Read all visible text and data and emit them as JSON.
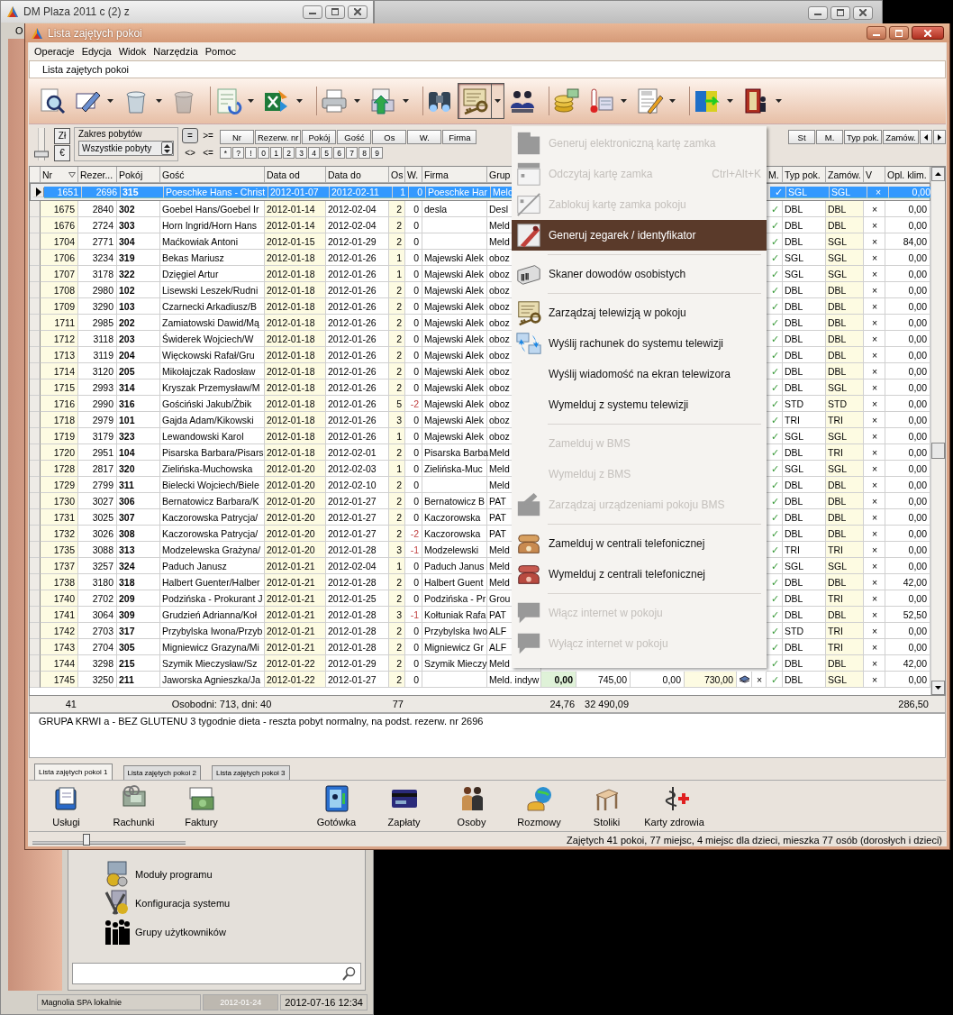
{
  "background_window": {
    "title": "DM Plaza 2011 c (2) z",
    "menu": [
      "O"
    ],
    "panel_items": [
      "Moduły programu",
      "Konfiguracja systemu",
      "Grupy użytkowników"
    ],
    "status_bar": [
      {
        "text": "Magnolia SPA lokalnie",
        "disabled": false
      },
      {
        "text": "2012-01-24",
        "disabled": true
      },
      {
        "text": "2012-07-16 12:34",
        "disabled": false
      }
    ]
  },
  "window": {
    "title": "Lista zajętych pokoi"
  },
  "menu_bar": [
    "Operacje",
    "Edycja",
    "Widok",
    "Narzędzia",
    "Pomoc"
  ],
  "document_tab": "Lista zajętych pokoi",
  "toolbar": [
    {
      "dropdown": false,
      "disabled": false,
      "pressed": false,
      "separator_before": false
    },
    {
      "dropdown": true,
      "disabled": false,
      "pressed": false,
      "separator_before": false
    },
    {
      "dropdown": true,
      "disabled": false,
      "pressed": false,
      "separator_before": false
    },
    {
      "dropdown": false,
      "disabled": true,
      "pressed": false,
      "separator_before": false
    },
    {
      "dropdown": true,
      "disabled": false,
      "pressed": false,
      "separator_before": true
    },
    {
      "dropdown": true,
      "disabled": false,
      "pressed": false,
      "separator_before": false
    },
    {
      "dropdown": true,
      "disabled": false,
      "pressed": false,
      "separator_before": true
    },
    {
      "dropdown": true,
      "disabled": false,
      "pressed": false,
      "separator_before": false
    },
    {
      "dropdown": false,
      "disabled": false,
      "pressed": false,
      "separator_before": true
    },
    {
      "dropdown": true,
      "disabled": false,
      "pressed": true,
      "separator_before": false
    },
    {
      "dropdown": false,
      "disabled": false,
      "pressed": false,
      "separator_before": false
    },
    {
      "dropdown": false,
      "disabled": false,
      "pressed": false,
      "separator_before": true
    },
    {
      "dropdown": true,
      "disabled": false,
      "pressed": false,
      "separator_before": false
    },
    {
      "dropdown": true,
      "disabled": false,
      "pressed": false,
      "separator_before": false
    },
    {
      "dropdown": true,
      "disabled": false,
      "pressed": false,
      "separator_before": true
    },
    {
      "dropdown": true,
      "disabled": false,
      "pressed": false,
      "separator_before": false
    }
  ],
  "filter": {
    "slider": {
      "level": 0.2
    },
    "currency_buttons": [
      "Zł",
      "€"
    ],
    "range": {
      "label": "Zakres pobytów",
      "value": "Wszystkie pobyty"
    },
    "operators": [
      {
        "label": "=",
        "selected": true
      },
      {
        "label": ">=",
        "selected": false
      },
      {
        "label": "<>",
        "selected": false
      },
      {
        "label": "<=",
        "selected": false
      }
    ],
    "column_buttons": [
      "Nr",
      "Rezerw. nr",
      "Pokój",
      "Gość",
      "Os",
      "W.",
      "Firma"
    ],
    "column_buttons_right": [
      "St",
      "M.",
      "Typ pok.",
      "Zamów."
    ],
    "char_buttons": [
      "*",
      "?",
      "!",
      "0",
      "1",
      "2",
      "3",
      "4",
      "5",
      "6",
      "7",
      "8",
      "9"
    ]
  },
  "table": {
    "columns": [
      "Nr",
      "Rezer...",
      "Pokój",
      "Gość",
      "Data od",
      "Data do",
      "Os",
      "W.",
      "Firma",
      "Grup",
      "M.",
      "Typ pok.",
      "Zamów.",
      "V",
      "Opl. klim."
    ],
    "rows": [
      {
        "nr": "1651",
        "rezerwacja": "2696",
        "pokoj": "315",
        "gosc": "Poeschke Hans - Christ",
        "data_od": "2012-01-07",
        "data_do": "2012-02-11",
        "os": "1",
        "w": "0",
        "firma": "Poeschke Har",
        "grupa": "Meld",
        "m": "✓",
        "typ_pok": "SGL",
        "zamow": "SGL",
        "v": "×",
        "opl_klim": "0,00",
        "selected": true
      },
      {
        "nr": "1675",
        "rezerwacja": "2840",
        "pokoj": "302",
        "gosc": "Goebel Hans/Goebel Ir",
        "data_od": "2012-01-14",
        "data_do": "2012-02-04",
        "os": "2",
        "w": "0",
        "firma": "desla",
        "grupa": "Desl",
        "m": "✓",
        "typ_pok": "DBL",
        "zamow": "DBL",
        "v": "×",
        "opl_klim": "0,00",
        "selected": false
      },
      {
        "nr": "1676",
        "rezerwacja": "2724",
        "pokoj": "303",
        "gosc": "Horn Ingrid/Horn Hans",
        "data_od": "2012-01-14",
        "data_do": "2012-02-04",
        "os": "2",
        "w": "0",
        "firma": "",
        "grupa": "Meld",
        "m": "✓",
        "typ_pok": "DBL",
        "zamow": "DBL",
        "v": "×",
        "opl_klim": "0,00",
        "selected": false
      },
      {
        "nr": "1704",
        "rezerwacja": "2771",
        "pokoj": "304",
        "gosc": "Maćkowiak Antoni",
        "data_od": "2012-01-15",
        "data_do": "2012-01-29",
        "os": "2",
        "w": "0",
        "firma": "",
        "grupa": "Meld",
        "m": "✓",
        "typ_pok": "DBL",
        "zamow": "SGL",
        "v": "×",
        "opl_klim": "84,00",
        "selected": false
      },
      {
        "nr": "1706",
        "rezerwacja": "3234",
        "pokoj": "319",
        "gosc": "Bekas Mariusz",
        "data_od": "2012-01-18",
        "data_do": "2012-01-26",
        "os": "1",
        "w": "0",
        "firma": "Majewski Alek",
        "grupa": "oboz",
        "m": "✓",
        "typ_pok": "SGL",
        "zamow": "SGL",
        "v": "×",
        "opl_klim": "0,00",
        "selected": false
      },
      {
        "nr": "1707",
        "rezerwacja": "3178",
        "pokoj": "322",
        "gosc": "Dzięgiel Artur",
        "data_od": "2012-01-18",
        "data_do": "2012-01-26",
        "os": "1",
        "w": "0",
        "firma": "Majewski Alek",
        "grupa": "oboz",
        "m": "✓",
        "typ_pok": "SGL",
        "zamow": "SGL",
        "v": "×",
        "opl_klim": "0,00",
        "selected": false
      },
      {
        "nr": "1708",
        "rezerwacja": "2980",
        "pokoj": "102",
        "gosc": "Lisewski Leszek/Rudni",
        "data_od": "2012-01-18",
        "data_do": "2012-01-26",
        "os": "2",
        "w": "0",
        "firma": "Majewski Alek",
        "grupa": "oboz",
        "m": "✓",
        "typ_pok": "DBL",
        "zamow": "DBL",
        "v": "×",
        "opl_klim": "0,00",
        "selected": false
      },
      {
        "nr": "1709",
        "rezerwacja": "3290",
        "pokoj": "103",
        "gosc": "Czarnecki Arkadiusz/B",
        "data_od": "2012-01-18",
        "data_do": "2012-01-26",
        "os": "2",
        "w": "0",
        "firma": "Majewski Alek",
        "grupa": "oboz",
        "m": "✓",
        "typ_pok": "DBL",
        "zamow": "DBL",
        "v": "×",
        "opl_klim": "0,00",
        "selected": false
      },
      {
        "nr": "1711",
        "rezerwacja": "2985",
        "pokoj": "202",
        "gosc": "Zamiatowski Dawid/Mą",
        "data_od": "2012-01-18",
        "data_do": "2012-01-26",
        "os": "2",
        "w": "0",
        "firma": "Majewski Alek",
        "grupa": "oboz",
        "m": "✓",
        "typ_pok": "DBL",
        "zamow": "DBL",
        "v": "×",
        "opl_klim": "0,00",
        "selected": false
      },
      {
        "nr": "1712",
        "rezerwacja": "3118",
        "pokoj": "203",
        "gosc": "Świderek Wojciech/W",
        "data_od": "2012-01-18",
        "data_do": "2012-01-26",
        "os": "2",
        "w": "0",
        "firma": "Majewski Alek",
        "grupa": "oboz",
        "m": "✓",
        "typ_pok": "DBL",
        "zamow": "DBL",
        "v": "×",
        "opl_klim": "0,00",
        "selected": false
      },
      {
        "nr": "1713",
        "rezerwacja": "3119",
        "pokoj": "204",
        "gosc": "Więckowski Rafał/Gru",
        "data_od": "2012-01-18",
        "data_do": "2012-01-26",
        "os": "2",
        "w": "0",
        "firma": "Majewski Alek",
        "grupa": "oboz",
        "m": "✓",
        "typ_pok": "DBL",
        "zamow": "DBL",
        "v": "×",
        "opl_klim": "0,00",
        "selected": false
      },
      {
        "nr": "1714",
        "rezerwacja": "3120",
        "pokoj": "205",
        "gosc": "Mikołajczak Radosław",
        "data_od": "2012-01-18",
        "data_do": "2012-01-26",
        "os": "2",
        "w": "0",
        "firma": "Majewski Alek",
        "grupa": "oboz",
        "m": "✓",
        "typ_pok": "DBL",
        "zamow": "DBL",
        "v": "×",
        "opl_klim": "0,00",
        "selected": false
      },
      {
        "nr": "1715",
        "rezerwacja": "2993",
        "pokoj": "314",
        "gosc": "Kryszak Przemysław/M",
        "data_od": "2012-01-18",
        "data_do": "2012-01-26",
        "os": "2",
        "w": "0",
        "firma": "Majewski Alek",
        "grupa": "oboz",
        "m": "✓",
        "typ_pok": "DBL",
        "zamow": "SGL",
        "v": "×",
        "opl_klim": "0,00",
        "selected": false
      },
      {
        "nr": "1716",
        "rezerwacja": "2990",
        "pokoj": "316",
        "gosc": "Gościński  Jakub/Żbik",
        "data_od": "2012-01-18",
        "data_do": "2012-01-26",
        "os": "5",
        "w": "-2",
        "firma": "Majewski Alek",
        "grupa": "oboz",
        "m": "✓",
        "typ_pok": "STD",
        "zamow": "STD",
        "v": "×",
        "opl_klim": "0,00",
        "selected": false
      },
      {
        "nr": "1718",
        "rezerwacja": "2979",
        "pokoj": "101",
        "gosc": "Gajda Adam/Kikowski",
        "data_od": "2012-01-18",
        "data_do": "2012-01-26",
        "os": "3",
        "w": "0",
        "firma": "Majewski Alek",
        "grupa": "oboz",
        "m": "✓",
        "typ_pok": "TRI",
        "zamow": "TRI",
        "v": "×",
        "opl_klim": "0,00",
        "selected": false
      },
      {
        "nr": "1719",
        "rezerwacja": "3179",
        "pokoj": "323",
        "gosc": "Lewandowski Karol",
        "data_od": "2012-01-18",
        "data_do": "2012-01-26",
        "os": "1",
        "w": "0",
        "firma": "Majewski Alek",
        "grupa": "oboz",
        "m": "✓",
        "typ_pok": "SGL",
        "zamow": "SGL",
        "v": "×",
        "opl_klim": "0,00",
        "selected": false
      },
      {
        "nr": "1720",
        "rezerwacja": "2951",
        "pokoj": "104",
        "gosc": "Pisarska Barbara/Pisars",
        "data_od": "2012-01-18",
        "data_do": "2012-02-01",
        "os": "2",
        "w": "0",
        "firma": "Pisarska Barba",
        "grupa": "Meld",
        "m": "✓",
        "typ_pok": "DBL",
        "zamow": "TRI",
        "v": "×",
        "opl_klim": "0,00",
        "selected": false
      },
      {
        "nr": "1728",
        "rezerwacja": "2817",
        "pokoj": "320",
        "gosc": "Zielińska-Muchowska",
        "data_od": "2012-01-20",
        "data_do": "2012-02-03",
        "os": "1",
        "w": "0",
        "firma": "Zielińska-Muc",
        "grupa": "Meld",
        "m": "✓",
        "typ_pok": "SGL",
        "zamow": "SGL",
        "v": "×",
        "opl_klim": "0,00",
        "selected": false
      },
      {
        "nr": "1729",
        "rezerwacja": "2799",
        "pokoj": "311",
        "gosc": "Bielecki Wojciech/Biele",
        "data_od": "2012-01-20",
        "data_do": "2012-02-10",
        "os": "2",
        "w": "0",
        "firma": "",
        "grupa": "Meld",
        "m": "✓",
        "typ_pok": "DBL",
        "zamow": "DBL",
        "v": "×",
        "opl_klim": "0,00",
        "selected": false
      },
      {
        "nr": "1730",
        "rezerwacja": "3027",
        "pokoj": "306",
        "gosc": "Bernatowicz Barbara/K",
        "data_od": "2012-01-20",
        "data_do": "2012-01-27",
        "os": "2",
        "w": "0",
        "firma": "Bernatowicz B",
        "grupa": "PAT",
        "m": "✓",
        "typ_pok": "DBL",
        "zamow": "DBL",
        "v": "×",
        "opl_klim": "0,00",
        "selected": false
      },
      {
        "nr": "1731",
        "rezerwacja": "3025",
        "pokoj": "307",
        "gosc": "Kaczorowska Patrycja/",
        "data_od": "2012-01-20",
        "data_do": "2012-01-27",
        "os": "2",
        "w": "0",
        "firma": "Kaczorowska",
        "grupa": "PAT",
        "m": "✓",
        "typ_pok": "DBL",
        "zamow": "DBL",
        "v": "×",
        "opl_klim": "0,00",
        "selected": false
      },
      {
        "nr": "1732",
        "rezerwacja": "3026",
        "pokoj": "308",
        "gosc": "Kaczorowska Patrycja/",
        "data_od": "2012-01-20",
        "data_do": "2012-01-27",
        "os": "2",
        "w": "-2",
        "firma": "Kaczorowska",
        "grupa": "PAT",
        "m": "✓",
        "typ_pok": "DBL",
        "zamow": "DBL",
        "v": "×",
        "opl_klim": "0,00",
        "selected": false
      },
      {
        "nr": "1735",
        "rezerwacja": "3088",
        "pokoj": "313",
        "gosc": "Modzelewska Grażyna/",
        "data_od": "2012-01-20",
        "data_do": "2012-01-28",
        "os": "3",
        "w": "-1",
        "firma": "Modzelewski",
        "grupa": "Meld",
        "m": "✓",
        "typ_pok": "TRI",
        "zamow": "TRI",
        "v": "×",
        "opl_klim": "0,00",
        "selected": false
      },
      {
        "nr": "1737",
        "rezerwacja": "3257",
        "pokoj": "324",
        "gosc": "Paduch Janusz",
        "data_od": "2012-01-21",
        "data_do": "2012-02-04",
        "os": "1",
        "w": "0",
        "firma": "Paduch Janus",
        "grupa": "Meld",
        "m": "✓",
        "typ_pok": "SGL",
        "zamow": "SGL",
        "v": "×",
        "opl_klim": "0,00",
        "selected": false
      },
      {
        "nr": "1738",
        "rezerwacja": "3180",
        "pokoj": "318",
        "gosc": "Halbert Guenter/Halber",
        "data_od": "2012-01-21",
        "data_do": "2012-01-28",
        "os": "2",
        "w": "0",
        "firma": "Halbert Guent",
        "grupa": "Meld",
        "m": "✓",
        "typ_pok": "DBL",
        "zamow": "DBL",
        "v": "×",
        "opl_klim": "42,00",
        "selected": false
      },
      {
        "nr": "1740",
        "rezerwacja": "2702",
        "pokoj": "209",
        "gosc": "Podzińska - Prokurant J",
        "data_od": "2012-01-21",
        "data_do": "2012-01-25",
        "os": "2",
        "w": "0",
        "firma": "Podzińska - Pr",
        "grupa": "Grou",
        "m": "✓",
        "typ_pok": "DBL",
        "zamow": "TRI",
        "v": "×",
        "opl_klim": "0,00",
        "selected": false
      },
      {
        "nr": "1741",
        "rezerwacja": "3064",
        "pokoj": "309",
        "gosc": "Grudzień Adrianna/Koł",
        "data_od": "2012-01-21",
        "data_do": "2012-01-28",
        "os": "3",
        "w": "-1",
        "firma": "Kołtuniak Rafa",
        "grupa": "PAT",
        "m": "✓",
        "typ_pok": "DBL",
        "zamow": "DBL",
        "v": "×",
        "opl_klim": "52,50",
        "selected": false
      },
      {
        "nr": "1742",
        "rezerwacja": "2703",
        "pokoj": "317",
        "gosc": "Przybylska Iwona/Przyb",
        "data_od": "2012-01-21",
        "data_do": "2012-01-28",
        "os": "2",
        "w": "0",
        "firma": "Przybylska Iwo",
        "grupa": "ALF",
        "m": "✓",
        "typ_pok": "STD",
        "zamow": "TRI",
        "v": "×",
        "opl_klim": "0,00",
        "selected": false
      },
      {
        "nr": "1743",
        "rezerwacja": "2704",
        "pokoj": "305",
        "gosc": "Migniewicz Grazyna/Mi",
        "data_od": "2012-01-21",
        "data_do": "2012-01-28",
        "os": "2",
        "w": "0",
        "firma": "Migniewicz Gr",
        "grupa": "ALF",
        "m": "✓",
        "typ_pok": "DBL",
        "zamow": "TRI",
        "v": "×",
        "opl_klim": "0,00",
        "selected": false
      },
      {
        "nr": "1744",
        "rezerwacja": "3298",
        "pokoj": "215",
        "gosc": "Szymik Mieczysław/Sz",
        "data_od": "2012-01-22",
        "data_do": "2012-01-29",
        "os": "2",
        "w": "0",
        "firma": "Szymik Mieczy",
        "grupa": "Meld",
        "m": "✓",
        "typ_pok": "DBL",
        "zamow": "DBL",
        "v": "×",
        "opl_klim": "42,00",
        "selected": false
      },
      {
        "nr": "1745",
        "rezerwacja": "3250",
        "pokoj": "211",
        "gosc": "Jaworska Agnieszka/Ja",
        "data_od": "2012-01-22",
        "data_do": "2012-01-27",
        "os": "2",
        "w": "0",
        "firma": "",
        "grupa": "Meld. indyw",
        "column_11": "0,00",
        "column_12": "745,00",
        "column_13": "0,00",
        "column_14": "730,00",
        "column_16": "×",
        "m": "✓",
        "typ_pok": "DBL",
        "zamow": "SGL",
        "v": "×",
        "opl_klim": "0,00",
        "selected": false
      }
    ]
  },
  "summary": {
    "nr": "41",
    "osobodni": "Osobodni: 713, dni: 40",
    "os": "77",
    "column_11": "24,76",
    "column_12": "32 490,09",
    "opl_klim": "286,50"
  },
  "note": "GRUPA KRWI a - BEZ GLUTENU 3 tygodnie dieta - reszta pobyt normalny, na podst. rezerw. nr 2696",
  "tabs": [
    {
      "label": "Lista zajętych pokoi 1",
      "selected": true
    },
    {
      "label": "Lista zajętych pokoi 2",
      "selected": false
    },
    {
      "label": "Lista zajętych pokoi 3",
      "selected": false
    }
  ],
  "actions": [
    {
      "label": "Usługi",
      "separator_before": false
    },
    {
      "label": "Rachunki",
      "separator_before": false
    },
    {
      "label": "Faktury",
      "separator_before": false
    },
    {
      "label": "Gotówka",
      "separator_before": true
    },
    {
      "label": "Zapłaty",
      "separator_before": false
    },
    {
      "label": "Osoby",
      "separator_before": false
    },
    {
      "label": "Rozmowy",
      "separator_before": false
    },
    {
      "label": "Stoliki",
      "separator_before": false
    },
    {
      "label": "Karty zdrowia",
      "separator_before": false
    }
  ],
  "status_slider": {
    "level": 0.35
  },
  "status_bar": "Zajętych 41 pokoi, 77 miejsc, 4 miejsc dla dzieci, mieszka 77 osób (dorosłych i dzieci)",
  "menu": {
    "items": [
      {
        "label": "Generuj elektroniczną kartę zamka",
        "disabled": true,
        "selected": false,
        "separator_after": false
      },
      {
        "label": "Odczytaj kartę zamka",
        "shortcut": "Ctrl+Alt+K",
        "disabled": true,
        "selected": false,
        "separator_after": false
      },
      {
        "label": "Zablokuj kartę zamka pokoju",
        "disabled": true,
        "selected": false,
        "separator_after": false
      },
      {
        "label": "Generuj zegarek / identyfikator",
        "disabled": false,
        "selected": true,
        "separator_after": true
      },
      {
        "label": "Skaner dowodów osobistych",
        "disabled": false,
        "selected": false,
        "separator_after": true
      },
      {
        "label": "Zarządzaj telewizją w pokoju",
        "disabled": false,
        "selected": false,
        "separator_after": false
      },
      {
        "label": "Wyślij rachunek do systemu telewizji",
        "disabled": false,
        "selected": false,
        "separator_after": false
      },
      {
        "label": "Wyślij wiadomość na ekran telewizora",
        "disabled": false,
        "selected": false,
        "separator_after": false
      },
      {
        "label": "Wymelduj z systemu telewizji",
        "disabled": false,
        "selected": false,
        "separator_after": true
      },
      {
        "label": "Zamelduj w BMS",
        "disabled": true,
        "selected": false,
        "separator_after": false
      },
      {
        "label": "Wymelduj z BMS",
        "disabled": true,
        "selected": false,
        "separator_after": false
      },
      {
        "label": "Zarządzaj urządzeniami pokoju BMS",
        "disabled": true,
        "selected": false,
        "separator_after": true
      },
      {
        "label": "Zamelduj w centrali telefonicznej",
        "disabled": false,
        "selected": false,
        "separator_after": false
      },
      {
        "label": "Wymelduj z centrali telefonicznej",
        "disabled": false,
        "selected": false,
        "separator_after": true
      },
      {
        "label": "Włącz internet w pokoju",
        "disabled": true,
        "selected": false,
        "separator_after": false
      },
      {
        "label": "Wyłącz internet w pokoju",
        "disabled": true,
        "selected": false,
        "separator_after": false
      }
    ]
  }
}
